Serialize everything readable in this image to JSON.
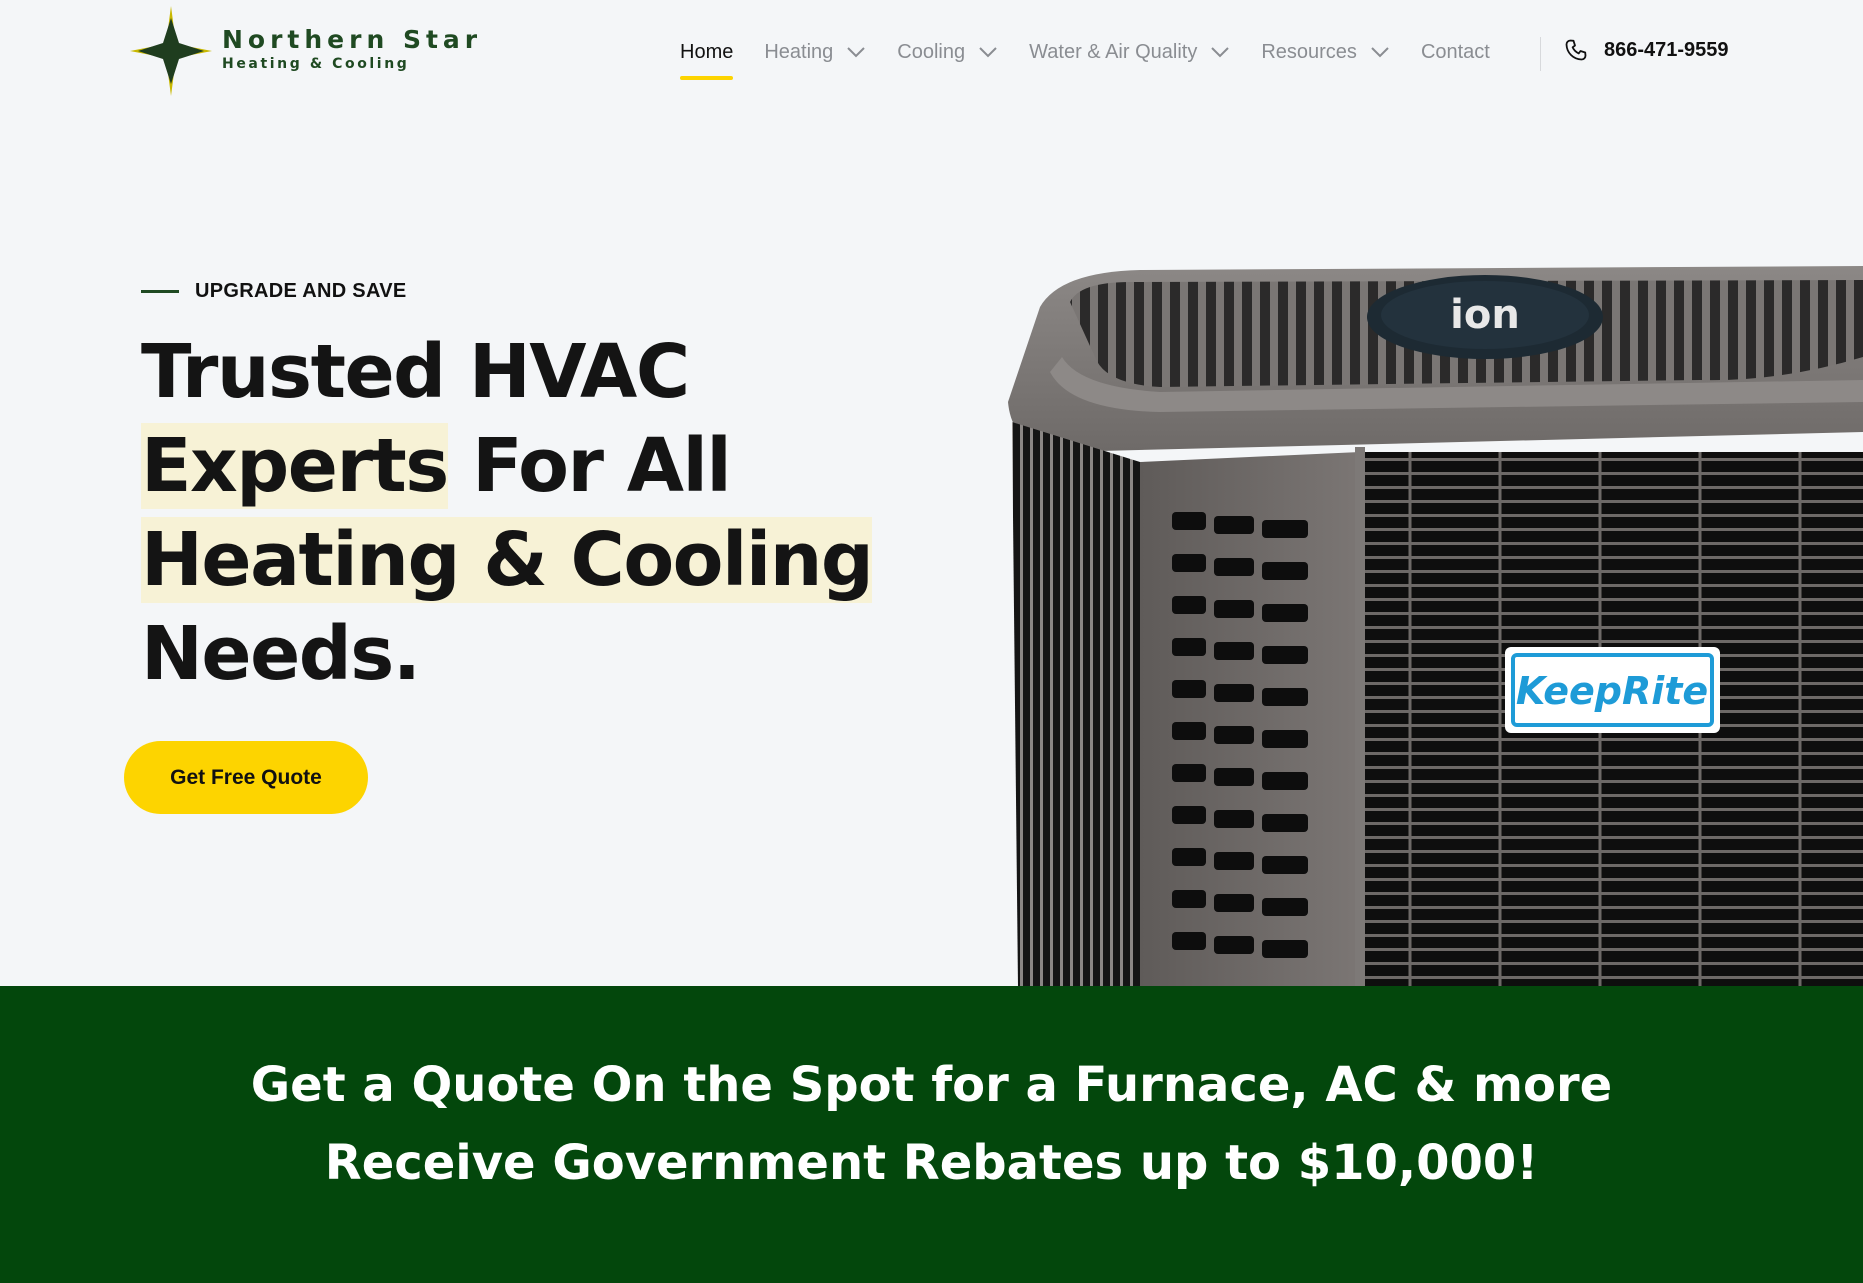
{
  "brand": {
    "name": "Northern Star",
    "tagline": "Heating & Cooling",
    "colors": {
      "green": "#1f4a22",
      "accent": "#fdd400",
      "banner": "#03470c"
    }
  },
  "nav": {
    "items": [
      {
        "label": "Home",
        "active": true,
        "has_dropdown": false
      },
      {
        "label": "Heating",
        "active": false,
        "has_dropdown": true
      },
      {
        "label": "Cooling",
        "active": false,
        "has_dropdown": true
      },
      {
        "label": "Water & Air Quality",
        "active": false,
        "has_dropdown": true
      },
      {
        "label": "Resources",
        "active": false,
        "has_dropdown": true
      },
      {
        "label": "Contact",
        "active": false,
        "has_dropdown": false
      }
    ],
    "phone": "866-471-9559",
    "phone_icon": "phone-icon"
  },
  "hero": {
    "eyebrow": "UPGRADE AND SAVE",
    "headline": {
      "line1": "Trusted HVAC",
      "line2_highlight": "Experts",
      "line2_rest": " For All",
      "line3_highlight": "Heating & Cooling",
      "line4": "Needs."
    },
    "cta_label": "Get Free Quote",
    "image": {
      "alt": "Air conditioner unit",
      "top_badge": "ion",
      "brand_label": "KeepRite"
    }
  },
  "banner": {
    "line1": "Get a Quote On the Spot for a Furnace, AC & more",
    "line2": "Receive Government Rebates up to $10,000!"
  }
}
